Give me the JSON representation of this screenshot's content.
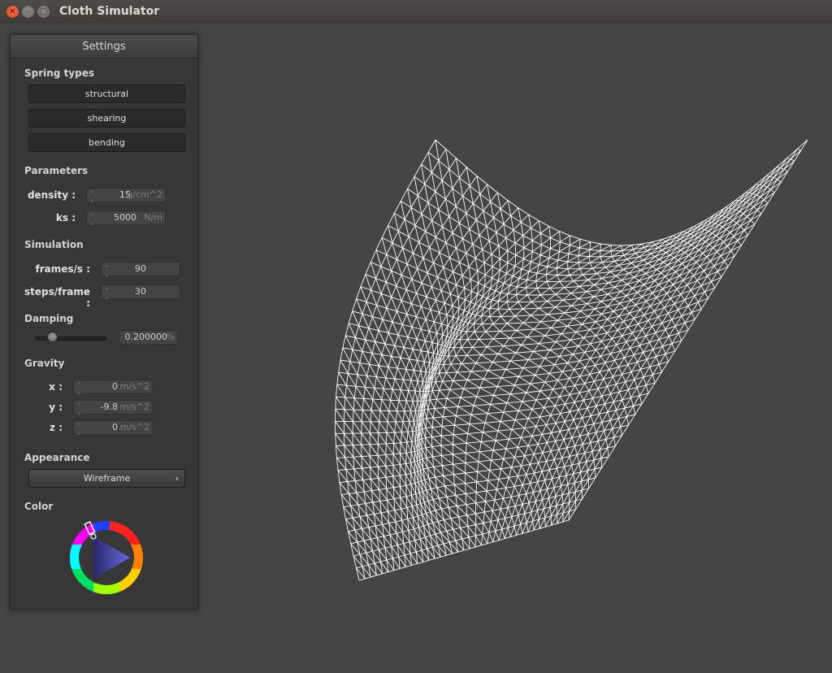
{
  "window": {
    "title": "Cloth Simulator"
  },
  "panel": {
    "title": "Settings"
  },
  "spring_types": {
    "heading": "Spring types",
    "buttons": [
      "structural",
      "shearing",
      "bending"
    ]
  },
  "parameters": {
    "heading": "Parameters",
    "density": {
      "label": "density :",
      "value": "15",
      "unit": "g/cm^2"
    },
    "ks": {
      "label": "ks :",
      "value": "5000",
      "unit": "N/m"
    }
  },
  "simulation": {
    "heading": "Simulation",
    "fps": {
      "label": "frames/s :",
      "value": "90"
    },
    "steps": {
      "label": "steps/frame :",
      "value": "30"
    }
  },
  "damping": {
    "heading": "Damping",
    "value": "0.200000",
    "unit": "%",
    "slider_fraction": 0.2
  },
  "gravity": {
    "heading": "Gravity",
    "x": {
      "label": "x :",
      "value": "0",
      "unit": "m/s^2"
    },
    "y": {
      "label": "y :",
      "value": "-9.8",
      "unit": "m/s^2"
    },
    "z": {
      "label": "z :",
      "value": "0",
      "unit": "m/s^2"
    }
  },
  "appearance": {
    "heading": "Appearance",
    "selected": "Wireframe"
  },
  "color": {
    "heading": "Color",
    "selected_hex": "#ffffff"
  },
  "icons": {
    "close": "close-icon",
    "minimize": "minimize-icon",
    "maximize": "maximize-icon",
    "spinner": "spinner-arrows-icon",
    "chevron": "chevron-right-icon"
  }
}
